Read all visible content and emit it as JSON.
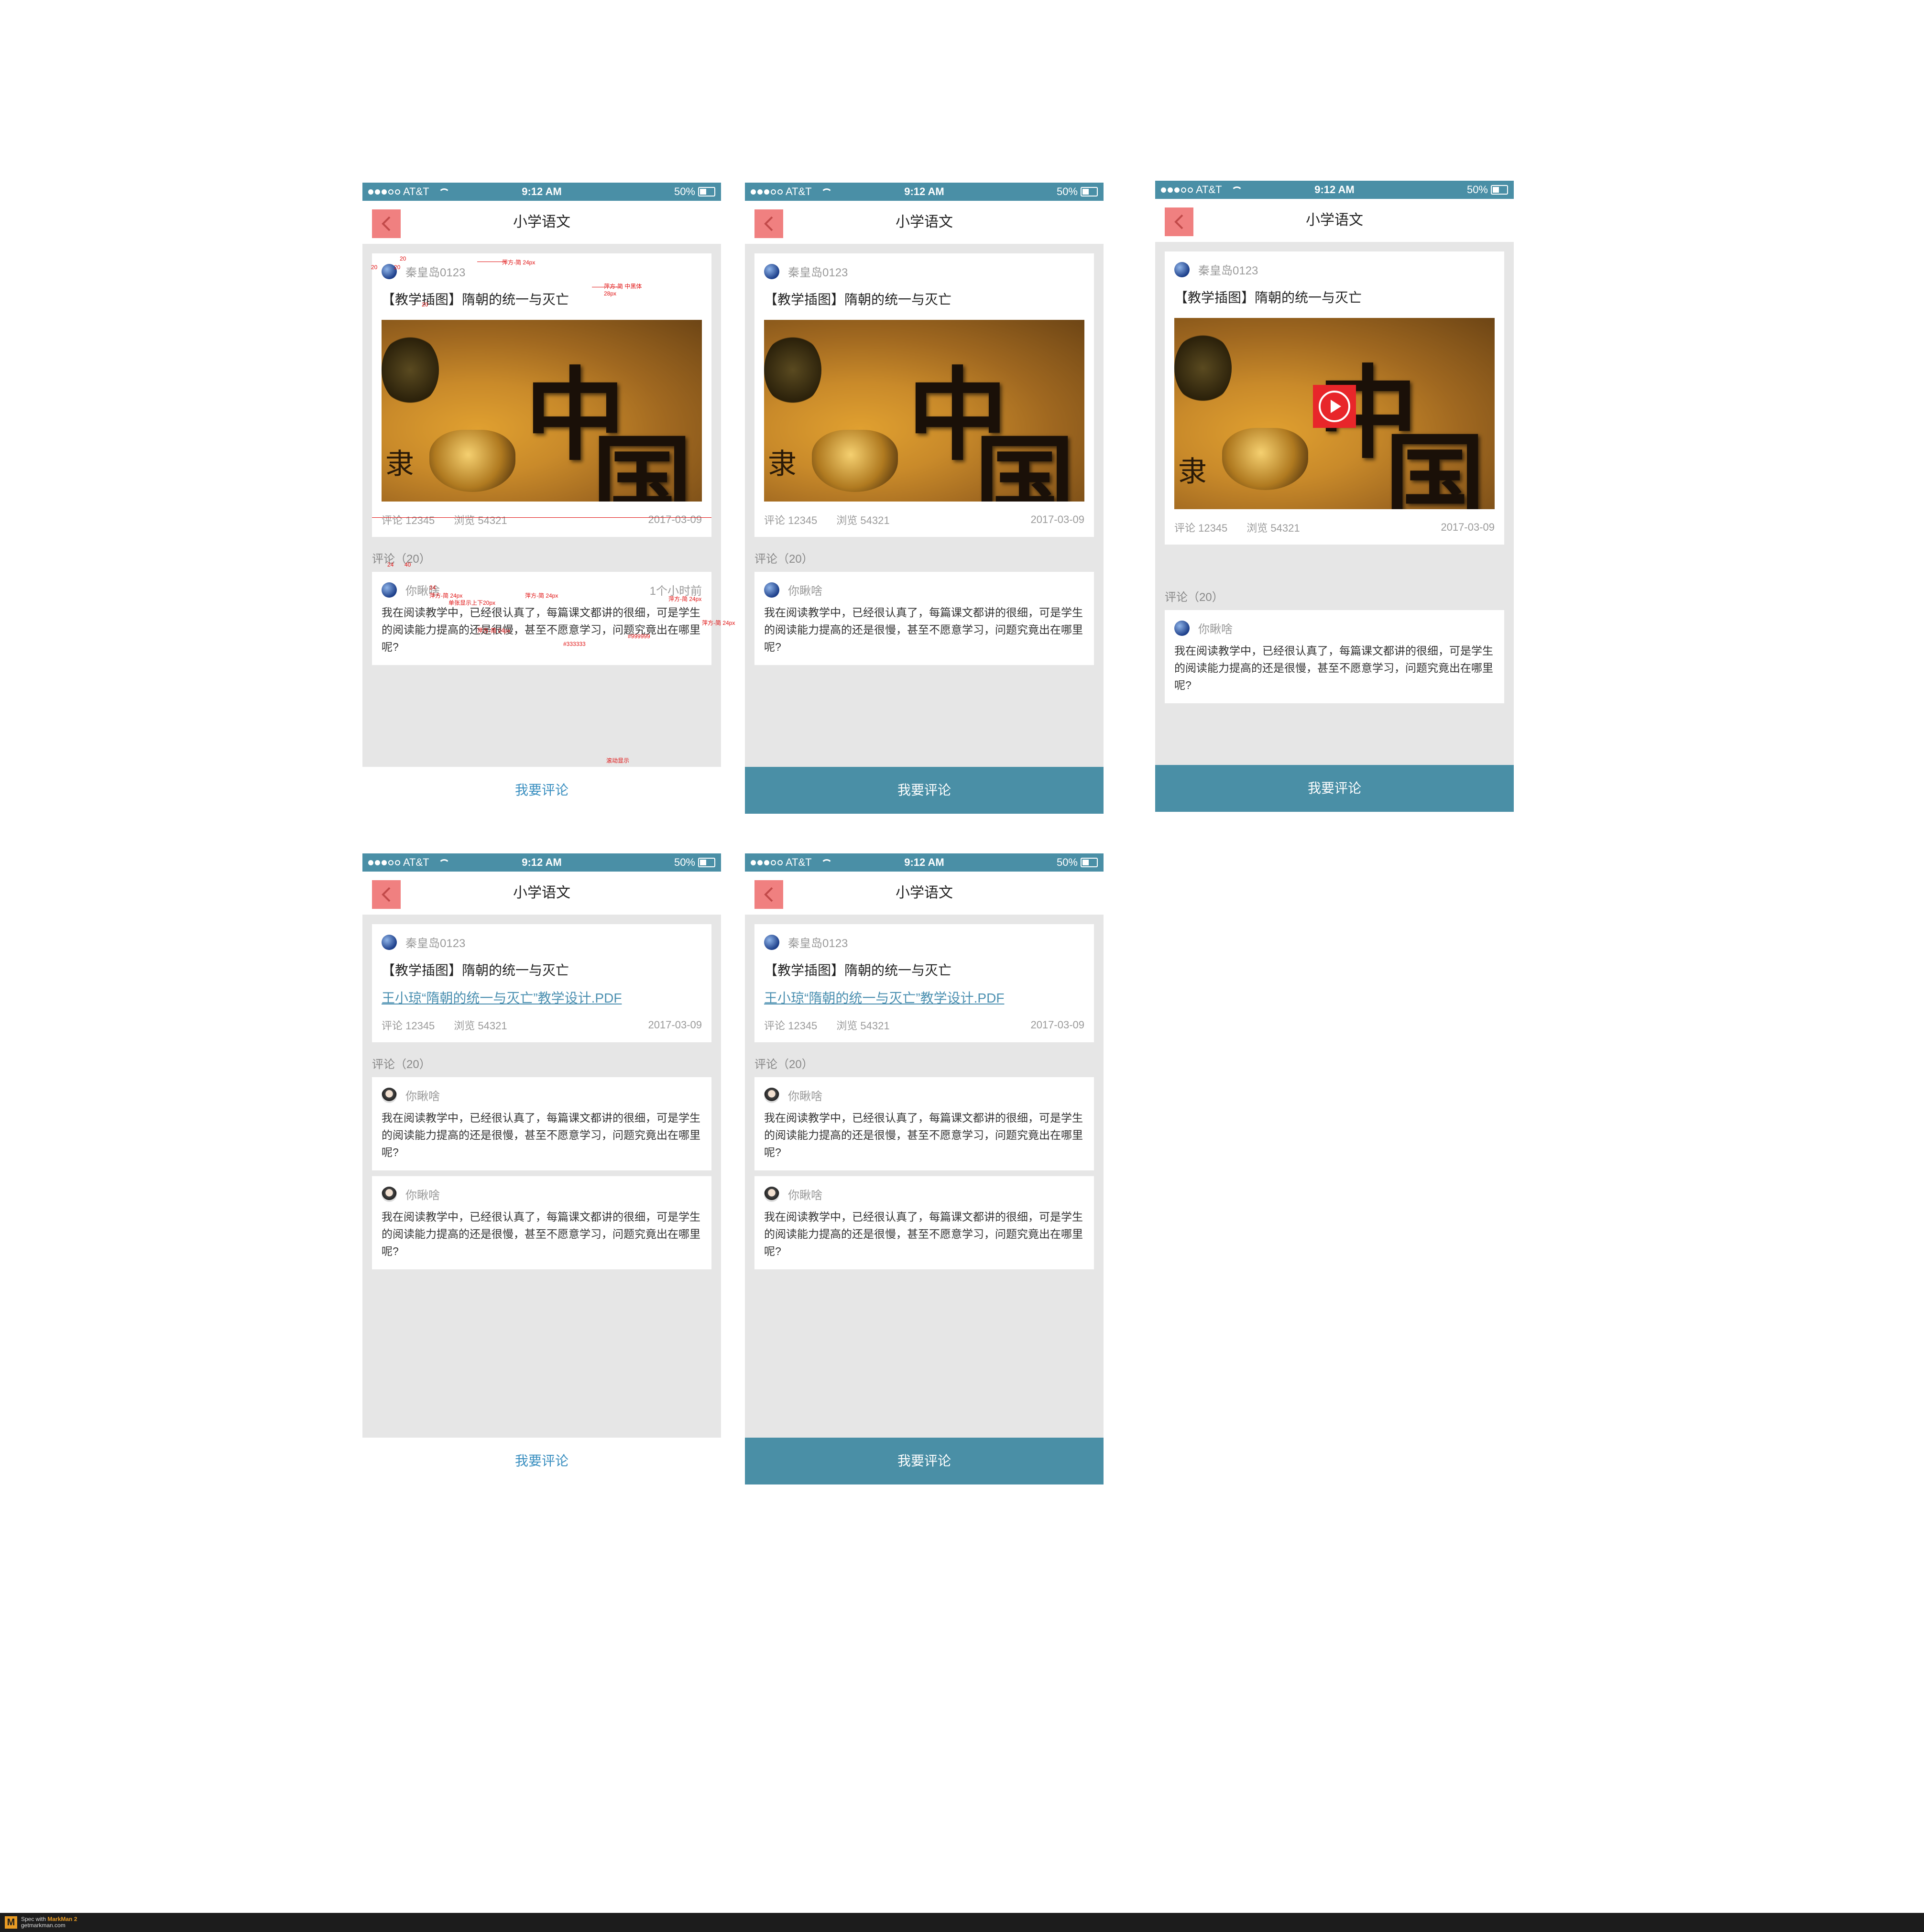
{
  "status": {
    "carrier": "AT&T",
    "time": "9:12 AM",
    "battery": "50%"
  },
  "nav": {
    "title": "小学语文"
  },
  "post": {
    "author": "秦皇岛0123",
    "title": "【教学插图】隋朝的统一与灭亡",
    "pdf_link": "王小琼“隋朝的统一与灭亡”教学设计.PDF",
    "comments_label": "评论 12345",
    "views_label": "浏览 54321",
    "date": "2017-03-09",
    "cover_glyphs": [
      "中",
      "国",
      "隶"
    ]
  },
  "comments": {
    "header": "评论（20）",
    "author": "你瞅啥",
    "time_ago": "1个小时前",
    "text": "我在阅读教学中，已经很认真了，每篇课文都讲的很细，可是学生的阅读能力提高的还是很慢，甚至不愿意学习，问题究竟出在哪里呢?"
  },
  "actions": {
    "comment_button": "我要评论"
  },
  "annotations": {
    "a1": "20",
    "a2": "20",
    "a3": "20",
    "a4": "20",
    "a5": "萍方-简 24px",
    "a6": "萍方-简 中黑体 28px",
    "a7": "24",
    "a8": "40",
    "a9": "24",
    "a10": "#999999",
    "a11": "萍方-简 24px",
    "a12": "萍方-简 24px",
    "a13": "萍方-简 24px",
    "a14": "#333333",
    "a15": "萍方-简 24px",
    "a16": "滚动显示",
    "a17": "单张显示上下20px",
    "a18": "萍方-简 24px",
    "play": "播放"
  },
  "footer": {
    "spec": "Spec with",
    "brand": "MarkMan 2",
    "site": "getmarkman.com"
  },
  "colors": {
    "accent": "#4a8fa6",
    "back": "#f08080",
    "play": "#e8262a",
    "link": "#4a8fb0"
  }
}
